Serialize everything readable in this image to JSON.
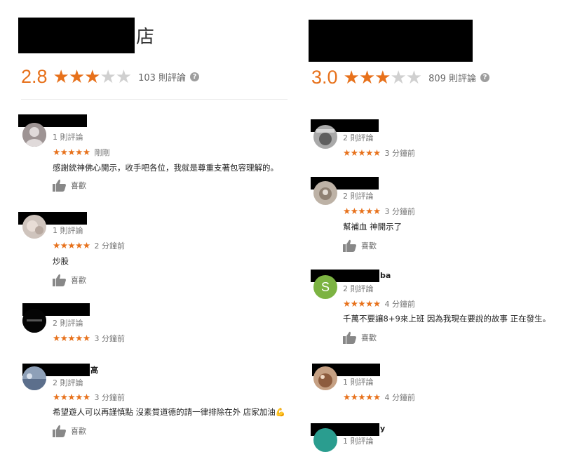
{
  "left_place": {
    "title_visible": "店",
    "rating": "2.8",
    "stars_filled": 3,
    "stars_total": 5,
    "review_count": "103 則評論",
    "help_icon": "question-circle-icon",
    "reviews": [
      {
        "meta": "1 則評論",
        "stars": "★★★★★",
        "time": "剛剛",
        "text": "感謝統神佛心開示，收手吧各位，我就是尊重支著包容理解的。",
        "like": "喜歡"
      },
      {
        "meta": "1 則評論",
        "stars": "★★★★★",
        "time": "2 分鐘前",
        "text": "炒股",
        "like": "喜歡"
      },
      {
        "meta": "2 則評論",
        "stars": "★★★★★",
        "time": "3 分鐘前",
        "text": "",
        "like": ""
      },
      {
        "name_tail": "高",
        "meta": "2 則評論",
        "stars": "★★★★★",
        "time": "3 分鐘前",
        "text": "希望遊人可以再謹慎點 沒素質道德的請一律排除在外 店家加油💪",
        "like": "喜歡"
      }
    ]
  },
  "right_place": {
    "rating": "3.0",
    "stars_filled": 3,
    "stars_total": 5,
    "review_count": "809 則評論",
    "help_icon": "question-circle-icon",
    "reviews": [
      {
        "meta": "2 則評論",
        "stars": "★★★★★",
        "time": "3 分鐘前",
        "text": "",
        "like": ""
      },
      {
        "meta": "2 則評論",
        "stars": "★★★★★",
        "time": "3 分鐘前",
        "text": "幫補血 神開示了",
        "like": "喜歡"
      },
      {
        "name_tail": "ba",
        "avatar_letter": "S",
        "meta": "2 則評論",
        "stars": "★★★★★",
        "time": "4 分鐘前",
        "text": "千萬不要讓8+9來上班 因為我現在要說的故事 正在發生。",
        "like": "喜歡"
      },
      {
        "meta": "1 則評論",
        "stars": "★★★★★",
        "time": "4 分鐘前",
        "text": "",
        "like": ""
      },
      {
        "name_tail": "y",
        "meta": "1 則評論",
        "stars": "",
        "time": "",
        "text": "",
        "like": ""
      }
    ]
  },
  "icons": {
    "like": "thumbs-up-icon",
    "star": "star-icon"
  },
  "colors": {
    "accent": "#e7711b",
    "star_empty": "#d0d0d0",
    "avatar_s": "#7cb342"
  }
}
